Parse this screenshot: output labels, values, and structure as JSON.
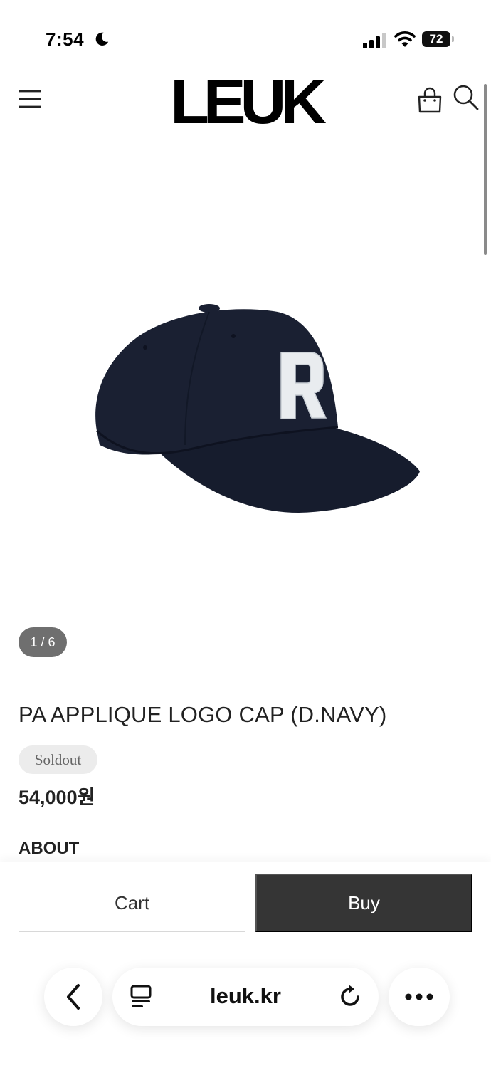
{
  "status_bar": {
    "time": "7:54",
    "battery": "72",
    "icons": [
      "moon-icon",
      "signal-icon",
      "wifi-icon",
      "battery-icon"
    ]
  },
  "header": {
    "brand": "LEUK",
    "icons": [
      "menu-icon",
      "shopping-bag-icon",
      "search-icon"
    ]
  },
  "product": {
    "image_counter": "1 / 6",
    "title": "PA APPLIQUE LOGO CAP (D.NAVY)",
    "status_badge": "Soldout",
    "price": "54,000원",
    "section_heading": "ABOUT",
    "image_colors": {
      "cap": "#151b2c",
      "letter": "#e9ecef"
    }
  },
  "actions": {
    "cart_label": "Cart",
    "buy_label": "Buy"
  },
  "browser": {
    "url": "leuk.kr",
    "icons": [
      "back-icon",
      "tabs-icon",
      "reload-icon",
      "more-icon"
    ]
  },
  "colors": {
    "buy_button": "#353535",
    "counter_pill": "#6f6f6f",
    "badge_bg": "#ececec"
  }
}
